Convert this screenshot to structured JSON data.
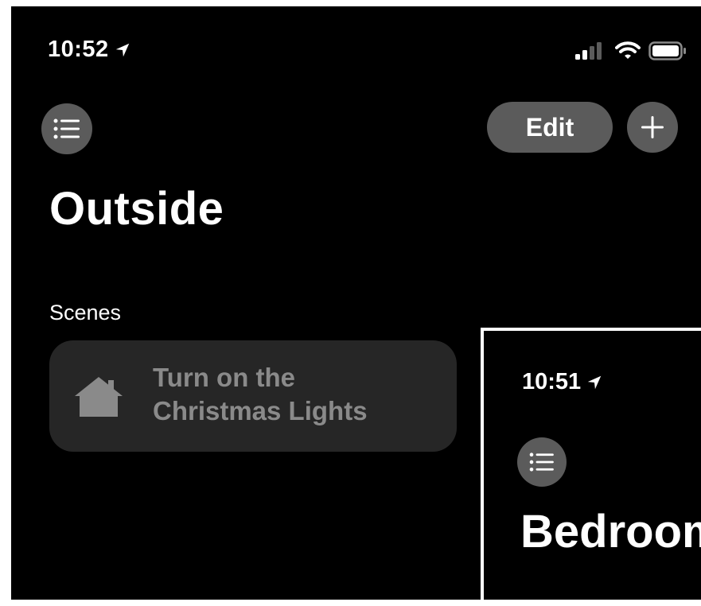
{
  "status_bar": {
    "time": "10:52",
    "icons": [
      "location-arrow-icon",
      "cellular-signal-icon",
      "wifi-icon",
      "battery-icon"
    ]
  },
  "toolbar": {
    "menu_icon": "list-icon",
    "edit_label": "Edit",
    "add_icon": "plus-icon"
  },
  "page": {
    "title": "Outside"
  },
  "scenes": {
    "label": "Scenes",
    "items": [
      {
        "icon": "house-icon",
        "name_line1": "Turn on the",
        "name_line2": "Christmas Lights"
      }
    ]
  },
  "inset_screenshot": {
    "time": "10:51",
    "menu_icon": "list-icon",
    "title": "Bedroom"
  },
  "colors": {
    "background": "#000000",
    "button_fill": "#5b5b5b",
    "tile_fill": "#262626",
    "tile_text": "#8a8a8a",
    "text": "#ffffff"
  }
}
